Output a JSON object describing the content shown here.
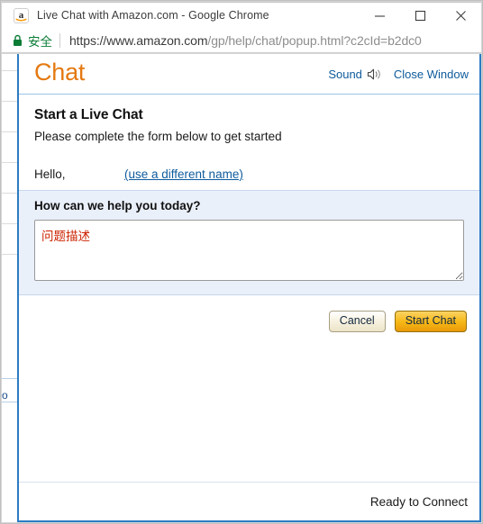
{
  "browser": {
    "title": "Live Chat with Amazon.com - Google Chrome",
    "favicon_name": "amazon-favicon",
    "window_controls": {
      "minimize": "minimize-icon",
      "maximize": "maximize-icon",
      "close": "close-icon"
    },
    "address_bar": {
      "security_label": "安全",
      "security_icon": "lock-icon",
      "url_origin": "https://www.amazon.com",
      "url_path": "/gp/help/chat/popup.html?c2cId=b2dc0",
      "url_full": "https://www.amazon.com/gp/help/chat/popup.html?c2cId=b2dc0"
    }
  },
  "chat": {
    "header": {
      "title": "Chat",
      "sound_label": "Sound",
      "sound_icon": "speaker-icon",
      "close_window_label": "Close Window"
    },
    "form": {
      "heading": "Start a Live Chat",
      "subheading": "Please complete the form below to get started",
      "hello_label": "Hello,",
      "customer_name": "",
      "different_name_link": "(use a different name)",
      "question_label": "How can we help you today?",
      "issue_value": "问题描述",
      "issue_placeholder": ""
    },
    "actions": {
      "cancel_label": "Cancel",
      "start_chat_label": "Start Chat"
    },
    "status": {
      "connection_text": "Ready to Connect"
    }
  },
  "background_page": {
    "sliver_text": "ro"
  },
  "colors": {
    "amazon_orange": "#e47911",
    "link_blue": "#0e5b9c",
    "secure_green": "#0b7c36",
    "panel_blue": "#eaf0fa",
    "card_border": "#2d7cc4",
    "issue_text_red": "#cc2200",
    "start_chat_gold": "#f6b816"
  }
}
